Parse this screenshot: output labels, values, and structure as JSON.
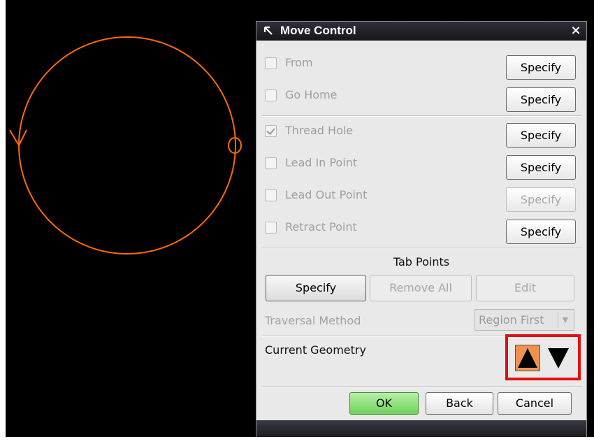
{
  "dialog": {
    "title": "Move Control",
    "close_label": "×",
    "options": [
      {
        "label": "From",
        "checked": false,
        "button": "Specify",
        "button_enabled": true
      },
      {
        "label": "Go Home",
        "checked": false,
        "button": "Specify",
        "button_enabled": true
      },
      {
        "label": "Thread Hole",
        "checked": true,
        "button": "Specify",
        "button_enabled": true
      },
      {
        "label": "Lead In Point",
        "checked": false,
        "button": "Specify",
        "button_enabled": true
      },
      {
        "label": "Lead Out Point",
        "checked": false,
        "button": "Specify",
        "button_enabled": false
      },
      {
        "label": "Retract Point",
        "checked": false,
        "button": "Specify",
        "button_enabled": true
      }
    ],
    "tab_points": {
      "title": "Tab Points",
      "specify": "Specify",
      "remove_all": "Remove All",
      "edit": "Edit"
    },
    "traversal": {
      "label": "Traversal Method",
      "value": "Region First"
    },
    "current_geometry": {
      "label": "Current Geometry"
    },
    "footer": {
      "ok": "OK",
      "back": "Back",
      "cancel": "Cancel"
    }
  },
  "colors": {
    "circle": "#ff6a00",
    "highlight": "#e01010",
    "ok_green": "#6fd25a",
    "up_button": "#f0924f"
  },
  "icons": [
    "title-arrow-icon",
    "close-icon",
    "check-icon",
    "up-triangle-icon",
    "down-triangle-icon",
    "dropdown-arrow-icon"
  ]
}
